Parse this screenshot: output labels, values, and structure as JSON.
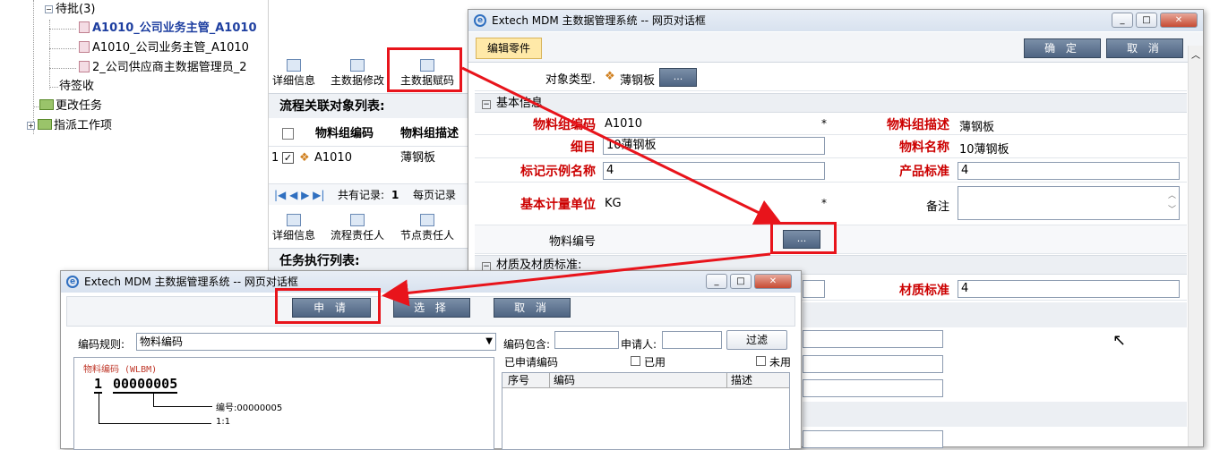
{
  "tree": {
    "pending_approval": "待批(3)",
    "items": [
      "A1010_公司业务主管_A1010",
      "A1010_公司业务主管_A1010",
      "2_公司供应商主数据管理员_2"
    ],
    "pending_receive": "待签收",
    "change_task": "更改任务",
    "assign_work": "指派工作项"
  },
  "middle": {
    "toolbar1": [
      "详细信息",
      "主数据修改",
      "主数据赋码"
    ],
    "section1": "流程关联对象列表:",
    "col_code": "物料组编码",
    "col_desc": "物料组描述",
    "row_index": "1",
    "row_code": "A1010",
    "row_desc": "薄钢板",
    "pager_total_label": "共有记录:",
    "pager_total": "1",
    "pager_per_page": "每页记录",
    "toolbar2": [
      "详细信息",
      "流程责任人",
      "节点责任人"
    ],
    "section2": "任务执行列表:"
  },
  "main_dialog": {
    "title": "Extech MDM 主数据管理系统 -- 网页对话框",
    "tab": "编辑零件",
    "ok": "确 定",
    "cancel": "取 消",
    "object_type_label": "对象类型.",
    "object_type_value": "薄钢板",
    "ellipsis": "...",
    "section_basic": "基本信息",
    "section_material": "材质及材质标准:",
    "fields": {
      "group_code_label": "物料组编码",
      "group_code_value": "A1010",
      "group_desc_label": "物料组描述",
      "group_desc_value": "薄钢板",
      "detail_label": "细目",
      "detail_value": "10薄钢板",
      "name_label": "物料名称",
      "name_value": "10薄钢板",
      "mark_label": "标记示例名称",
      "mark_value": "4",
      "standard_label": "产品标准",
      "standard_value": "4",
      "unit_label": "基本计量单位",
      "unit_value": "KG",
      "remark_label": "备注",
      "material_no_label": "物料编号",
      "material_std_label": "材质标准",
      "material_std_value": "4",
      "required_mark": "*"
    }
  },
  "code_dialog": {
    "title": "Extech MDM 主数据管理系统 -- 网页对话框",
    "apply": "申 请",
    "select": "选 择",
    "cancel": "取 消",
    "rule_label": "编码规则:",
    "rule_value": "物料编码",
    "contains_label": "编码包含:",
    "applicant_label": "申请人:",
    "filter": "过滤",
    "applied_label": "已申请编码",
    "used_label": "已用",
    "unused_label": "未用",
    "col_seq": "序号",
    "col_code": "编码",
    "col_desc": "描述",
    "diagram_title": "物料编码 (WLBM)",
    "seg1": "1",
    "seg2": "00000005",
    "serial_label": "编号:00000005",
    "ratio_label": "1:1"
  }
}
